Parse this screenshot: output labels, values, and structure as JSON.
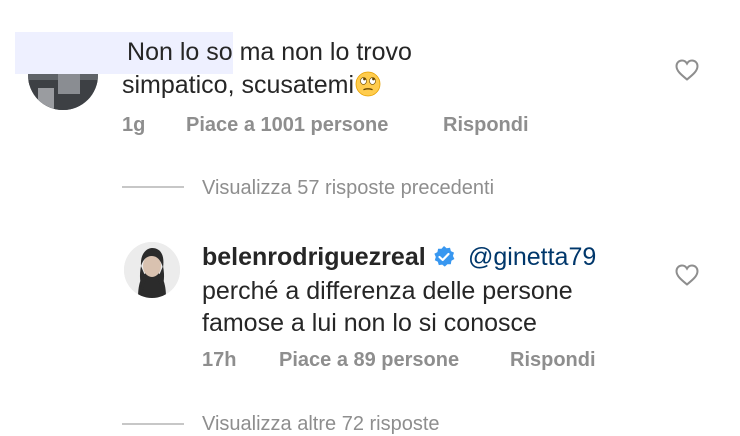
{
  "comment": {
    "text_line1": "Non lo so ma non lo trovo",
    "text_line2": "simpatico, scusatemi",
    "emoji_icon": "face-with-rolling-eyes-icon",
    "time": "1g",
    "likes": "Piace a 1001 persone",
    "reply_label": "Rispondi"
  },
  "view_previous": "Visualizza 57 risposte precedenti",
  "reply": {
    "username": "belenrodriguezreal",
    "mention": "@ginetta79",
    "text_line1": "perché a differenza delle persone",
    "text_line2": "famose a lui non lo si conosce",
    "time": "17h",
    "likes": "Piace a 89 persone",
    "reply_label": "Rispondi"
  },
  "view_more": "Visualizza altre 72 risposte",
  "colors": {
    "text": "#262626",
    "meta": "#8e8e8e",
    "mention": "#00376b",
    "verified": "#3897f0"
  }
}
